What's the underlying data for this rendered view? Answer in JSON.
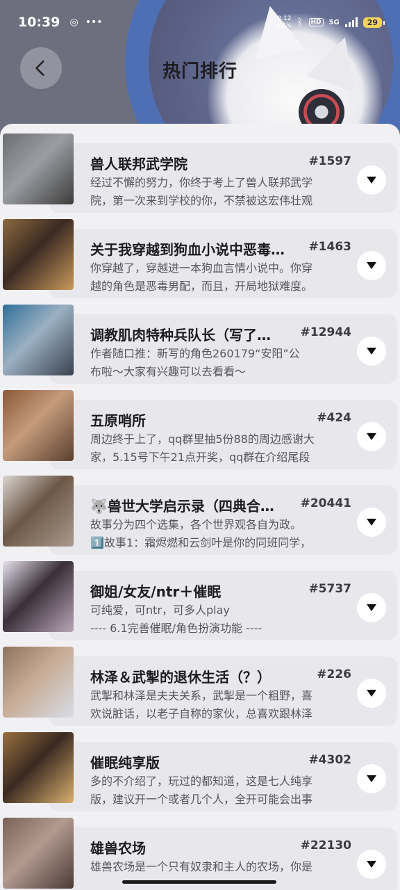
{
  "status_bar": {
    "time": "10:39",
    "net_speed_value": "0.12",
    "net_speed_unit": "KB/s",
    "hd": "HD",
    "network": "5G",
    "battery": "29"
  },
  "header": {
    "title": "热门排行"
  },
  "items": [
    {
      "name": "兽人联邦武学院",
      "rank": "#1597",
      "line1": "经过不懈的努力，你终于考上了兽人联邦武学",
      "line2": "院，第一次来到学校的你，不禁被这宏伟壮观",
      "thumb_colors": [
        "#6b6f73",
        "#9a9ea3",
        "#3d3b3a"
      ]
    },
    {
      "name": "关于我穿越到狗血小说中恶毒…",
      "rank": "#1463",
      "line1": "你穿越了，穿越进一本狗血言情小说中。你穿",
      "line2": "越的角色是恶毒男配，而且，开局地狱难度。",
      "thumb_colors": [
        "#8c6a3e",
        "#3b2a22",
        "#c99a5a"
      ]
    },
    {
      "name": "调教肌肉特种兵队长（写了…",
      "rank": "#12944",
      "line1": "作者随口推：新写的角色260179“安阳”公",
      "line2": "布啦～大家有兴趣可以去看看～",
      "thumb_colors": [
        "#2f6f9a",
        "#9bb0c2",
        "#39414f"
      ]
    },
    {
      "name": "五原哨所",
      "rank": "#424",
      "line1": "周边终于上了，qq群里抽5份88的周边感谢大",
      "line2": "家，5.15号下午21点开奖，qq群在介绍尾段",
      "thumb_colors": [
        "#8a5a3a",
        "#c49a7a",
        "#5a4030"
      ]
    },
    {
      "name": "🐺兽世大学启示录（四典合…",
      "rank": "#20441",
      "line1": "故事分为四个选集，各个世界观各自为政。",
      "line2": "1️⃣故事1：霜烬燃和云剑叶是你的同班同学，",
      "thumb_colors": [
        "#d9d5cf",
        "#6d5848",
        "#a89a8c"
      ]
    },
    {
      "name": "御姐/女友/ntr＋催眠",
      "rank": "#5737",
      "line1": "可纯爱，可ntr，可多人play",
      "line2": "---- 6.1完善催眠/角色扮演功能 ----",
      "thumb_colors": [
        "#e9e3ee",
        "#3a2f3a",
        "#b8a7b8"
      ]
    },
    {
      "name": "林泽＆武掣的退休生活（？）",
      "rank": "#226",
      "line1": "武掣和林泽是夫夫关系，武掣是一个粗野，喜",
      "line2": "欢说脏话，以老子自称的家伙，总喜欢跟林泽",
      "thumb_colors": [
        "#8f735c",
        "#c7ab93",
        "#d8dde6"
      ]
    },
    {
      "name": "催眠纯享版",
      "rank": "#4302",
      "line1": "多的不介绍了，玩过的都知道，这是七人纯享",
      "line2": "版，建议开一个或者几个人，全开可能会出事",
      "thumb_colors": [
        "#9a7040",
        "#3a2a20",
        "#d8b070"
      ]
    },
    {
      "name": "雄兽农场",
      "rank": "#22130",
      "line1": "雄兽农场是一个只有奴隶和主人的农场，你是",
      "line2": "",
      "thumb_colors": [
        "#7a6258",
        "#b39a90",
        "#4a3a34"
      ]
    }
  ]
}
